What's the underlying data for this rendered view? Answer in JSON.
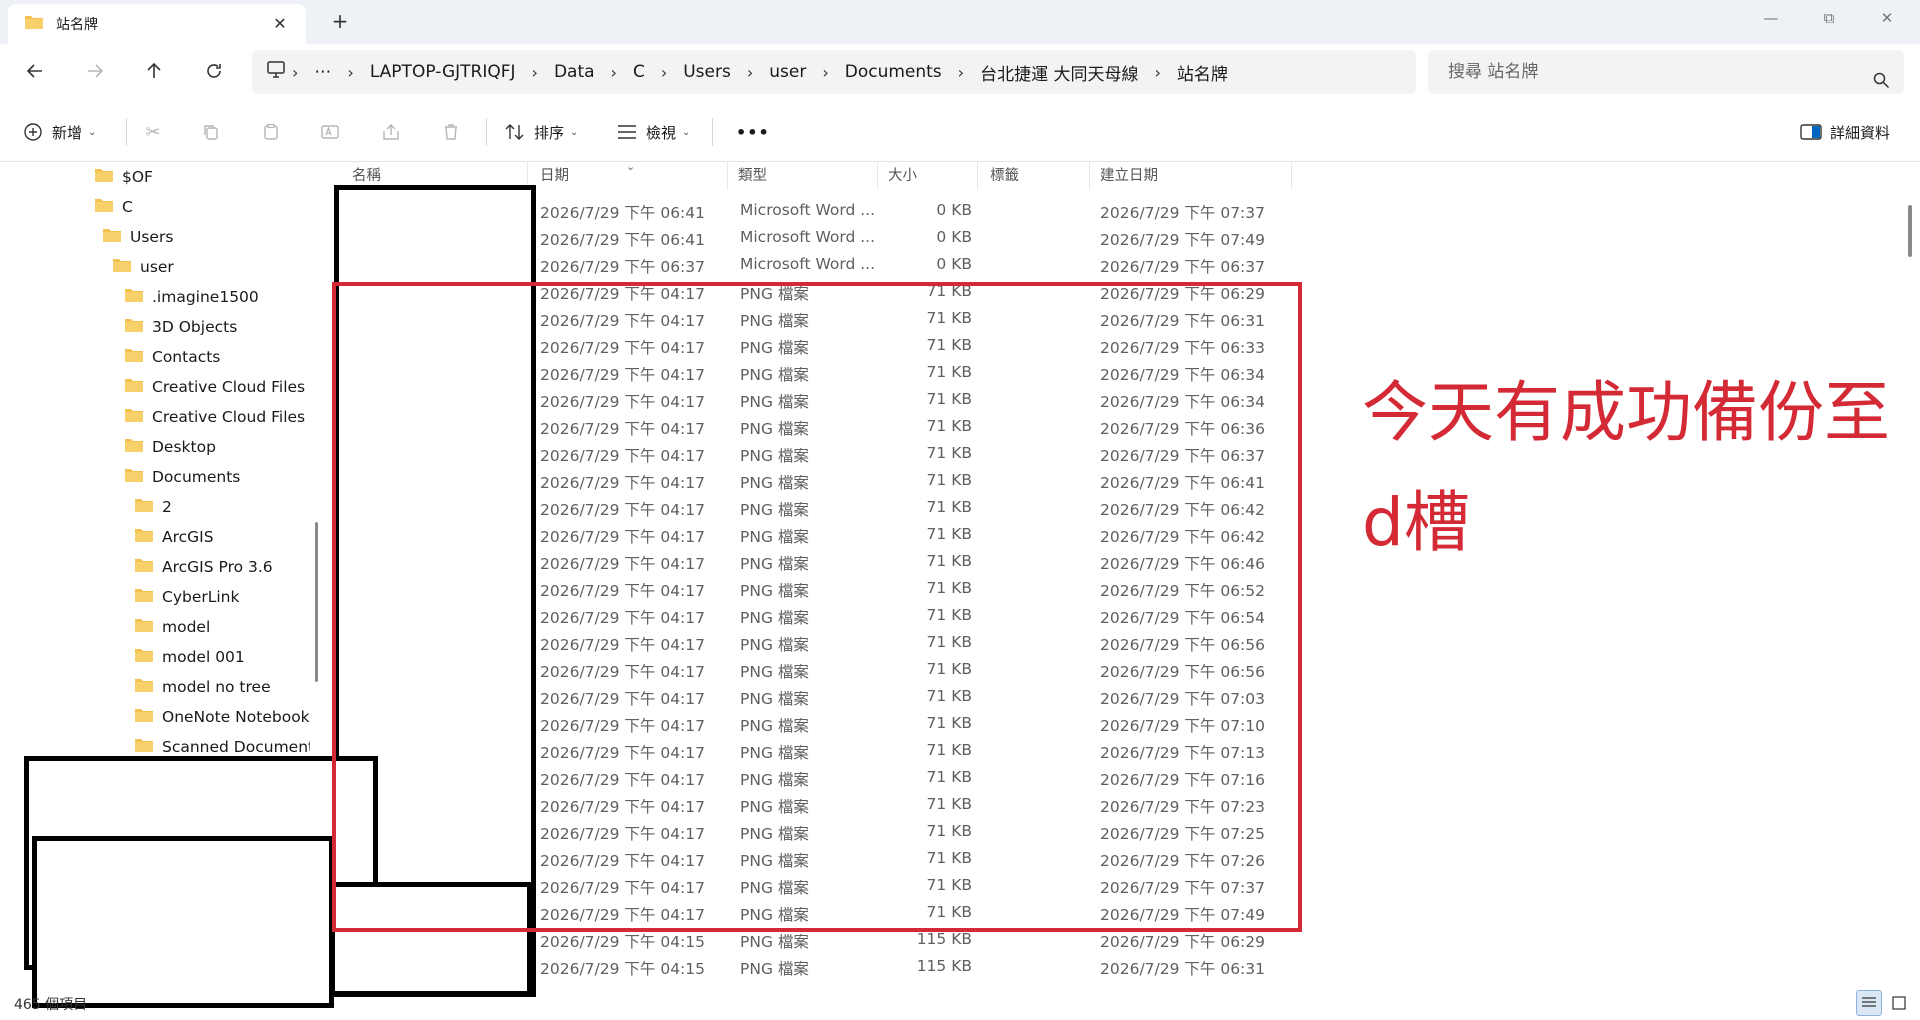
{
  "window": {
    "tab_title": "站名牌",
    "tab_close": "✕",
    "new_tab": "+",
    "minimize": "—",
    "restore": "⧉",
    "close": "✕"
  },
  "address": {
    "more": "⋯",
    "crumbs": [
      "LAPTOP-GJTRIQFJ",
      "Data",
      "C",
      "Users",
      "user",
      "Documents",
      "台北捷運 大同天母線",
      "站名牌"
    ],
    "search_placeholder": "搜尋 站名牌"
  },
  "toolbar": {
    "new_label": "新增",
    "sort_label": "排序",
    "view_label": "檢視",
    "more": "•••",
    "details_label": "詳細資料"
  },
  "sidebar": {
    "items": [
      {
        "label": "$OF",
        "level": 0
      },
      {
        "label": "C",
        "level": 0
      },
      {
        "label": "Users",
        "level": 1
      },
      {
        "label": "user",
        "level": 2
      },
      {
        "label": ".imagine1500",
        "level": 3
      },
      {
        "label": "3D Objects",
        "level": 3
      },
      {
        "label": "Contacts",
        "level": 3
      },
      {
        "label": "Creative Cloud Files  sh",
        "level": 3
      },
      {
        "label": "Creative Cloud Files sh",
        "level": 3
      },
      {
        "label": "Desktop",
        "level": 3
      },
      {
        "label": "Documents",
        "level": 3
      },
      {
        "label": "2",
        "level": 4
      },
      {
        "label": "ArcGIS",
        "level": 4
      },
      {
        "label": "ArcGIS Pro 3.6",
        "level": 4
      },
      {
        "label": "CyberLink",
        "level": 4
      },
      {
        "label": "model",
        "level": 4
      },
      {
        "label": "model 001",
        "level": 4
      },
      {
        "label": "model no tree",
        "level": 4
      },
      {
        "label": "OneNote Notebooks",
        "level": 4
      },
      {
        "label": "Scanned Documents",
        "level": 4
      }
    ]
  },
  "columns": {
    "name": "名稱",
    "date": "日期",
    "type": "類型",
    "size": "大小",
    "tags": "標籤",
    "created": "建立日期"
  },
  "files": [
    {
      "date": "2026/7/29 下午 06:41",
      "type": "Microsoft Word ...",
      "size": "0 KB",
      "created": "2026/7/29 下午 07:37"
    },
    {
      "date": "2026/7/29 下午 06:41",
      "type": "Microsoft Word ...",
      "size": "0 KB",
      "created": "2026/7/29 下午 07:49"
    },
    {
      "date": "2026/7/29 下午 06:37",
      "type": "Microsoft Word ...",
      "size": "0 KB",
      "created": "2026/7/29 下午 06:37"
    },
    {
      "date": "2026/7/29 下午 04:17",
      "type": "PNG 檔案",
      "size": "71 KB",
      "created": "2026/7/29 下午 06:29"
    },
    {
      "date": "2026/7/29 下午 04:17",
      "type": "PNG 檔案",
      "size": "71 KB",
      "created": "2026/7/29 下午 06:31"
    },
    {
      "date": "2026/7/29 下午 04:17",
      "type": "PNG 檔案",
      "size": "71 KB",
      "created": "2026/7/29 下午 06:33"
    },
    {
      "date": "2026/7/29 下午 04:17",
      "type": "PNG 檔案",
      "size": "71 KB",
      "created": "2026/7/29 下午 06:34"
    },
    {
      "date": "2026/7/29 下午 04:17",
      "type": "PNG 檔案",
      "size": "71 KB",
      "created": "2026/7/29 下午 06:34"
    },
    {
      "date": "2026/7/29 下午 04:17",
      "type": "PNG 檔案",
      "size": "71 KB",
      "created": "2026/7/29 下午 06:36"
    },
    {
      "date": "2026/7/29 下午 04:17",
      "type": "PNG 檔案",
      "size": "71 KB",
      "created": "2026/7/29 下午 06:37"
    },
    {
      "date": "2026/7/29 下午 04:17",
      "type": "PNG 檔案",
      "size": "71 KB",
      "created": "2026/7/29 下午 06:41"
    },
    {
      "date": "2026/7/29 下午 04:17",
      "type": "PNG 檔案",
      "size": "71 KB",
      "created": "2026/7/29 下午 06:42"
    },
    {
      "date": "2026/7/29 下午 04:17",
      "type": "PNG 檔案",
      "size": "71 KB",
      "created": "2026/7/29 下午 06:42"
    },
    {
      "date": "2026/7/29 下午 04:17",
      "type": "PNG 檔案",
      "size": "71 KB",
      "created": "2026/7/29 下午 06:46"
    },
    {
      "date": "2026/7/29 下午 04:17",
      "type": "PNG 檔案",
      "size": "71 KB",
      "created": "2026/7/29 下午 06:52"
    },
    {
      "date": "2026/7/29 下午 04:17",
      "type": "PNG 檔案",
      "size": "71 KB",
      "created": "2026/7/29 下午 06:54"
    },
    {
      "date": "2026/7/29 下午 04:17",
      "type": "PNG 檔案",
      "size": "71 KB",
      "created": "2026/7/29 下午 06:56"
    },
    {
      "date": "2026/7/29 下午 04:17",
      "type": "PNG 檔案",
      "size": "71 KB",
      "created": "2026/7/29 下午 06:56"
    },
    {
      "date": "2026/7/29 下午 04:17",
      "type": "PNG 檔案",
      "size": "71 KB",
      "created": "2026/7/29 下午 07:03"
    },
    {
      "date": "2026/7/29 下午 04:17",
      "type": "PNG 檔案",
      "size": "71 KB",
      "created": "2026/7/29 下午 07:10"
    },
    {
      "date": "2026/7/29 下午 04:17",
      "type": "PNG 檔案",
      "size": "71 KB",
      "created": "2026/7/29 下午 07:13"
    },
    {
      "date": "2026/7/29 下午 04:17",
      "type": "PNG 檔案",
      "size": "71 KB",
      "created": "2026/7/29 下午 07:16"
    },
    {
      "date": "2026/7/29 下午 04:17",
      "type": "PNG 檔案",
      "size": "71 KB",
      "created": "2026/7/29 下午 07:23"
    },
    {
      "date": "2026/7/29 下午 04:17",
      "type": "PNG 檔案",
      "size": "71 KB",
      "created": "2026/7/29 下午 07:25"
    },
    {
      "date": "2026/7/29 下午 04:17",
      "type": "PNG 檔案",
      "size": "71 KB",
      "created": "2026/7/29 下午 07:26"
    },
    {
      "date": "2026/7/29 下午 04:17",
      "type": "PNG 檔案",
      "size": "71 KB",
      "created": "2026/7/29 下午 07:37"
    },
    {
      "date": "2026/7/29 下午 04:17",
      "type": "PNG 檔案",
      "size": "71 KB",
      "created": "2026/7/29 下午 07:49"
    },
    {
      "date": "2026/7/29 下午 04:15",
      "type": "PNG 檔案",
      "size": "115 KB",
      "created": "2026/7/29 下午 06:29"
    },
    {
      "date": "2026/7/29 下午 04:15",
      "type": "PNG 檔案",
      "size": "115 KB",
      "created": "2026/7/29 下午 06:31"
    }
  ],
  "annotation": {
    "line1": "今天有成功備份至",
    "line2": "d槽",
    "color": "#d42a35"
  },
  "status": {
    "item_count": "465 個項目"
  },
  "colors": {
    "folder": "#f2c250",
    "accent": "#0067c0"
  }
}
